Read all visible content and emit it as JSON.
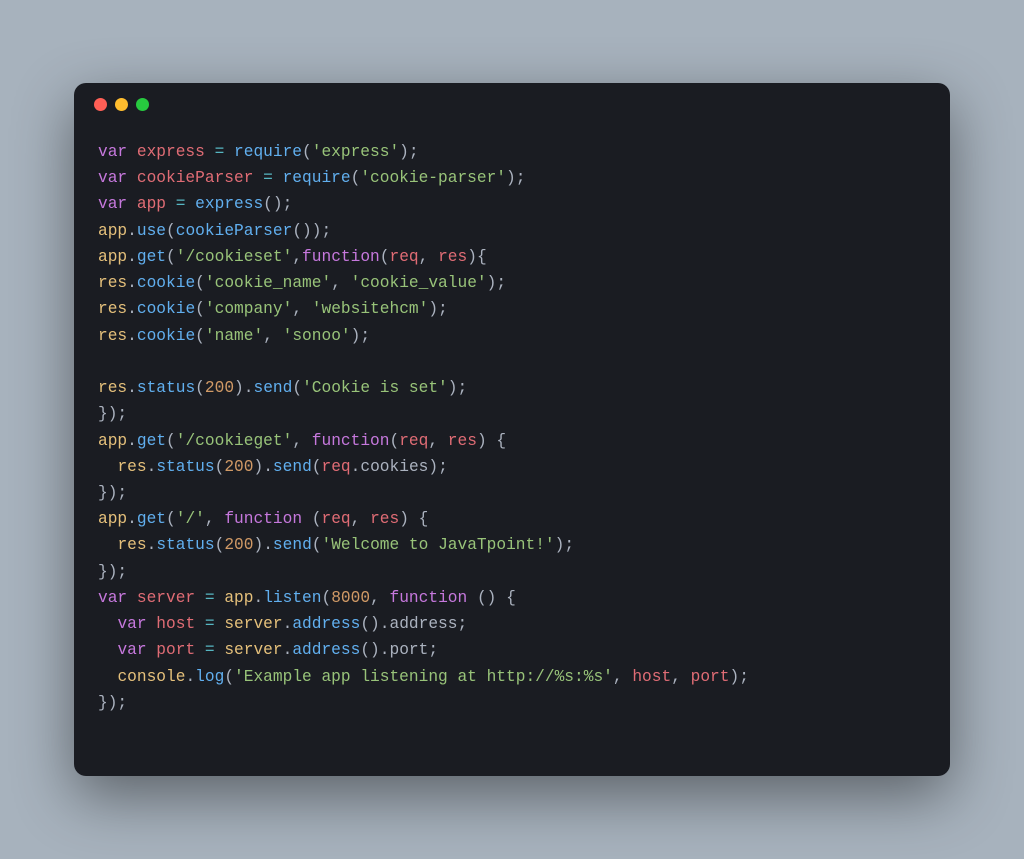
{
  "window": {
    "traffic_lights": [
      "close",
      "minimize",
      "zoom"
    ]
  },
  "code": {
    "lines": [
      [
        [
          "kw",
          "var "
        ],
        [
          "var",
          "express"
        ],
        [
          "punc",
          " "
        ],
        [
          "op",
          "="
        ],
        [
          "punc",
          " "
        ],
        [
          "fn",
          "require"
        ],
        [
          "punc",
          "("
        ],
        [
          "str",
          "'express'"
        ],
        [
          "punc",
          ");"
        ]
      ],
      [
        [
          "kw",
          "var "
        ],
        [
          "var",
          "cookieParser"
        ],
        [
          "punc",
          " "
        ],
        [
          "op",
          "="
        ],
        [
          "punc",
          " "
        ],
        [
          "fn",
          "require"
        ],
        [
          "punc",
          "("
        ],
        [
          "str",
          "'cookie-parser'"
        ],
        [
          "punc",
          ");"
        ]
      ],
      [
        [
          "kw",
          "var "
        ],
        [
          "var",
          "app"
        ],
        [
          "punc",
          " "
        ],
        [
          "op",
          "="
        ],
        [
          "punc",
          " "
        ],
        [
          "fn",
          "express"
        ],
        [
          "punc",
          "();"
        ]
      ],
      [
        [
          "obj",
          "app"
        ],
        [
          "punc",
          "."
        ],
        [
          "fn",
          "use"
        ],
        [
          "punc",
          "("
        ],
        [
          "fn",
          "cookieParser"
        ],
        [
          "punc",
          "());"
        ]
      ],
      [
        [
          "obj",
          "app"
        ],
        [
          "punc",
          "."
        ],
        [
          "fn",
          "get"
        ],
        [
          "punc",
          "("
        ],
        [
          "str",
          "'/cookieset'"
        ],
        [
          "punc",
          ","
        ],
        [
          "kw",
          "function"
        ],
        [
          "punc",
          "("
        ],
        [
          "var",
          "req"
        ],
        [
          "punc",
          ", "
        ],
        [
          "var",
          "res"
        ],
        [
          "punc",
          "){"
        ]
      ],
      [
        [
          "obj",
          "res"
        ],
        [
          "punc",
          "."
        ],
        [
          "fn",
          "cookie"
        ],
        [
          "punc",
          "("
        ],
        [
          "str",
          "'cookie_name'"
        ],
        [
          "punc",
          ", "
        ],
        [
          "str",
          "'cookie_value'"
        ],
        [
          "punc",
          ");"
        ]
      ],
      [
        [
          "obj",
          "res"
        ],
        [
          "punc",
          "."
        ],
        [
          "fn",
          "cookie"
        ],
        [
          "punc",
          "("
        ],
        [
          "str",
          "'company'"
        ],
        [
          "punc",
          ", "
        ],
        [
          "str",
          "'websitehcm'"
        ],
        [
          "punc",
          ");"
        ]
      ],
      [
        [
          "obj",
          "res"
        ],
        [
          "punc",
          "."
        ],
        [
          "fn",
          "cookie"
        ],
        [
          "punc",
          "("
        ],
        [
          "str",
          "'name'"
        ],
        [
          "punc",
          ", "
        ],
        [
          "str",
          "'sonoo'"
        ],
        [
          "punc",
          ");"
        ]
      ],
      [
        [
          "punc",
          ""
        ]
      ],
      [
        [
          "obj",
          "res"
        ],
        [
          "punc",
          "."
        ],
        [
          "fn",
          "status"
        ],
        [
          "punc",
          "("
        ],
        [
          "num",
          "200"
        ],
        [
          "punc",
          ")."
        ],
        [
          "fn",
          "send"
        ],
        [
          "punc",
          "("
        ],
        [
          "str",
          "'Cookie is set'"
        ],
        [
          "punc",
          ");"
        ]
      ],
      [
        [
          "punc",
          "});"
        ]
      ],
      [
        [
          "obj",
          "app"
        ],
        [
          "punc",
          "."
        ],
        [
          "fn",
          "get"
        ],
        [
          "punc",
          "("
        ],
        [
          "str",
          "'/cookieget'"
        ],
        [
          "punc",
          ", "
        ],
        [
          "kw",
          "function"
        ],
        [
          "punc",
          "("
        ],
        [
          "var",
          "req"
        ],
        [
          "punc",
          ", "
        ],
        [
          "var",
          "res"
        ],
        [
          "punc",
          ") {"
        ]
      ],
      [
        [
          "punc",
          "  "
        ],
        [
          "obj",
          "res"
        ],
        [
          "punc",
          "."
        ],
        [
          "fn",
          "status"
        ],
        [
          "punc",
          "("
        ],
        [
          "num",
          "200"
        ],
        [
          "punc",
          ")."
        ],
        [
          "fn",
          "send"
        ],
        [
          "punc",
          "("
        ],
        [
          "var",
          "req"
        ],
        [
          "punc",
          "."
        ],
        [
          "prop",
          "cookies"
        ],
        [
          "punc",
          ");"
        ]
      ],
      [
        [
          "punc",
          "});"
        ]
      ],
      [
        [
          "obj",
          "app"
        ],
        [
          "punc",
          "."
        ],
        [
          "fn",
          "get"
        ],
        [
          "punc",
          "("
        ],
        [
          "str",
          "'/'"
        ],
        [
          "punc",
          ", "
        ],
        [
          "kw",
          "function "
        ],
        [
          "punc",
          "("
        ],
        [
          "var",
          "req"
        ],
        [
          "punc",
          ", "
        ],
        [
          "var",
          "res"
        ],
        [
          "punc",
          ") {"
        ]
      ],
      [
        [
          "punc",
          "  "
        ],
        [
          "obj",
          "res"
        ],
        [
          "punc",
          "."
        ],
        [
          "fn",
          "status"
        ],
        [
          "punc",
          "("
        ],
        [
          "num",
          "200"
        ],
        [
          "punc",
          ")."
        ],
        [
          "fn",
          "send"
        ],
        [
          "punc",
          "("
        ],
        [
          "str",
          "'Welcome to JavaTpoint!'"
        ],
        [
          "punc",
          ");"
        ]
      ],
      [
        [
          "punc",
          "});"
        ]
      ],
      [
        [
          "kw",
          "var "
        ],
        [
          "var",
          "server"
        ],
        [
          "punc",
          " "
        ],
        [
          "op",
          "="
        ],
        [
          "punc",
          " "
        ],
        [
          "obj",
          "app"
        ],
        [
          "punc",
          "."
        ],
        [
          "fn",
          "listen"
        ],
        [
          "punc",
          "("
        ],
        [
          "num",
          "8000"
        ],
        [
          "punc",
          ", "
        ],
        [
          "kw",
          "function "
        ],
        [
          "punc",
          "() {"
        ]
      ],
      [
        [
          "punc",
          "  "
        ],
        [
          "kw",
          "var "
        ],
        [
          "var",
          "host"
        ],
        [
          "punc",
          " "
        ],
        [
          "op",
          "="
        ],
        [
          "punc",
          " "
        ],
        [
          "obj",
          "server"
        ],
        [
          "punc",
          "."
        ],
        [
          "fn",
          "address"
        ],
        [
          "punc",
          "()."
        ],
        [
          "prop",
          "address"
        ],
        [
          "punc",
          ";"
        ]
      ],
      [
        [
          "punc",
          "  "
        ],
        [
          "kw",
          "var "
        ],
        [
          "var",
          "port"
        ],
        [
          "punc",
          " "
        ],
        [
          "op",
          "="
        ],
        [
          "punc",
          " "
        ],
        [
          "obj",
          "server"
        ],
        [
          "punc",
          "."
        ],
        [
          "fn",
          "address"
        ],
        [
          "punc",
          "()."
        ],
        [
          "prop",
          "port"
        ],
        [
          "punc",
          ";"
        ]
      ],
      [
        [
          "punc",
          "  "
        ],
        [
          "obj",
          "console"
        ],
        [
          "punc",
          "."
        ],
        [
          "fn",
          "log"
        ],
        [
          "punc",
          "("
        ],
        [
          "str",
          "'Example app listening at http://%s:%s'"
        ],
        [
          "punc",
          ", "
        ],
        [
          "var",
          "host"
        ],
        [
          "punc",
          ", "
        ],
        [
          "var",
          "port"
        ],
        [
          "punc",
          ");"
        ]
      ],
      [
        [
          "punc",
          "});"
        ]
      ]
    ]
  }
}
